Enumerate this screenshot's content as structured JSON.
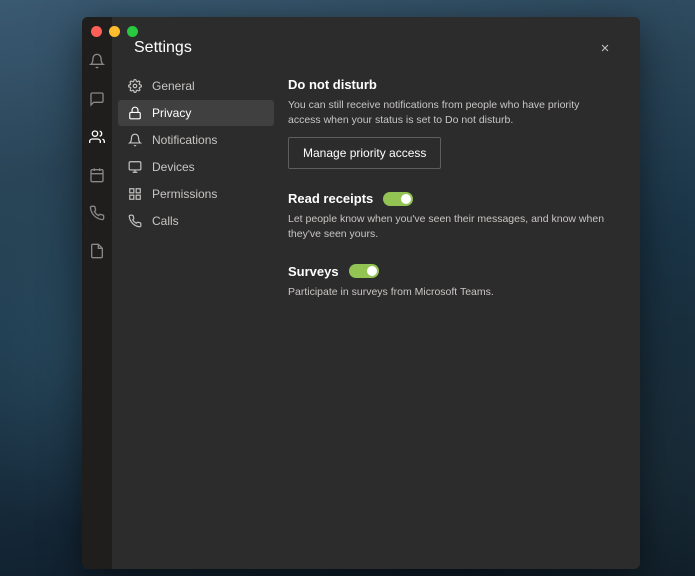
{
  "window": {
    "title": "Settings"
  },
  "rail": {
    "items": [
      {
        "name": "activity",
        "label": "Activity"
      },
      {
        "name": "chat",
        "label": "Chat"
      },
      {
        "name": "teams",
        "label": "Teams"
      },
      {
        "name": "calendar",
        "label": "Calendar"
      },
      {
        "name": "calls",
        "label": "Calls"
      },
      {
        "name": "files",
        "label": "Files"
      }
    ]
  },
  "nav": {
    "items": [
      {
        "label": "General"
      },
      {
        "label": "Privacy"
      },
      {
        "label": "Notifications"
      },
      {
        "label": "Devices"
      },
      {
        "label": "Permissions"
      },
      {
        "label": "Calls"
      }
    ],
    "selected": 1
  },
  "sections": {
    "dnd": {
      "title": "Do not disturb",
      "desc": "You can still receive notifications from people who have priority access when your status is set to Do not disturb.",
      "button": "Manage priority access"
    },
    "receipts": {
      "title": "Read receipts",
      "desc": "Let people know when you've seen their messages, and know when they've seen yours.",
      "toggle": true
    },
    "surveys": {
      "title": "Surveys",
      "desc": "Participate in surveys from Microsoft Teams.",
      "toggle": true
    }
  }
}
